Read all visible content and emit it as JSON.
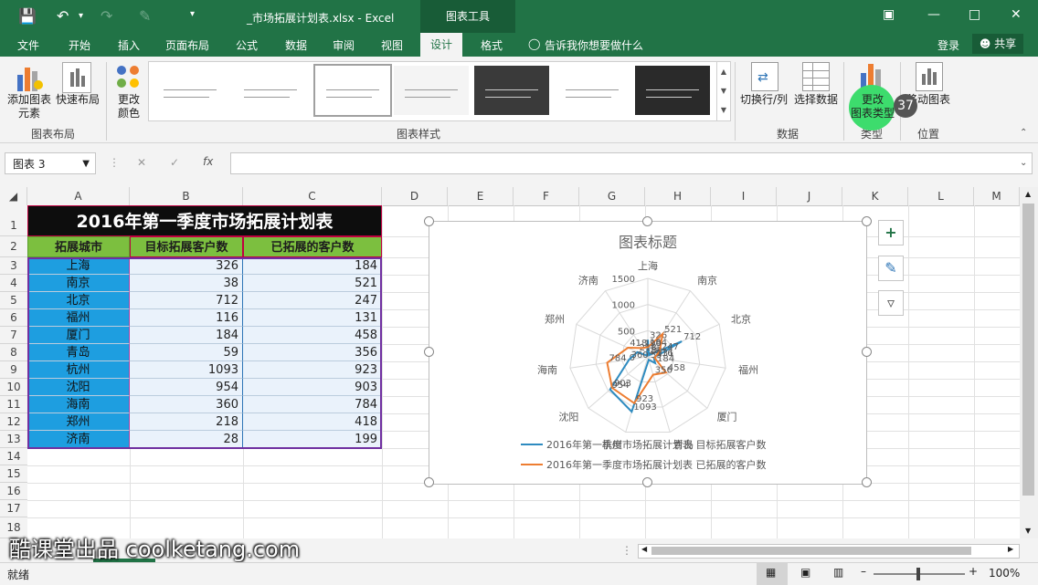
{
  "titlebar": {
    "doc_title": "_市场拓展计划表.xlsx - Excel",
    "context_tab": "图表工具",
    "signin": "登录",
    "share": "共享"
  },
  "tabs": [
    "文件",
    "开始",
    "插入",
    "页面布局",
    "公式",
    "数据",
    "审阅",
    "视图",
    "设计",
    "格式"
  ],
  "tellme": "告诉我你想要做什么",
  "ribbon": {
    "add_element": "添加图表\n元素",
    "quick_layout": "快速布局",
    "change_colors": "更改\n颜色",
    "switch_rowcol": "切换行/列",
    "select_data": "选择数据",
    "change_type": "更改\n图表类型",
    "move_chart": "移动图表",
    "groups": [
      "图表布局",
      "图表样式",
      "数据",
      "类型",
      "位置"
    ]
  },
  "namebox": "图表 3",
  "columns": [
    "A",
    "B",
    "C",
    "D",
    "E",
    "F",
    "G",
    "H",
    "I",
    "J",
    "K",
    "L",
    "M"
  ],
  "rows": [
    "1",
    "2",
    "3",
    "4",
    "5",
    "6",
    "7",
    "8",
    "9",
    "10",
    "11",
    "12",
    "13",
    "14",
    "15",
    "16",
    "17",
    "18"
  ],
  "sheet": {
    "title": "2016年第一季度市场拓展计划表",
    "headers": [
      "拓展城市",
      "目标拓展客户数",
      "已拓展的客户数"
    ],
    "data": [
      [
        "上海",
        "326",
        "184"
      ],
      [
        "南京",
        "38",
        "521"
      ],
      [
        "北京",
        "712",
        "247"
      ],
      [
        "福州",
        "116",
        "131"
      ],
      [
        "厦门",
        "184",
        "458"
      ],
      [
        "青岛",
        "59",
        "356"
      ],
      [
        "杭州",
        "1093",
        "923"
      ],
      [
        "沈阳",
        "954",
        "903"
      ],
      [
        "海南",
        "360",
        "784"
      ],
      [
        "郑州",
        "218",
        "418"
      ],
      [
        "济南",
        "28",
        "199"
      ]
    ]
  },
  "chart_data": {
    "type": "radar",
    "title": "图表标题",
    "categories": [
      "上海",
      "南京",
      "北京",
      "福州",
      "厦门",
      "青岛",
      "杭州",
      "沈阳",
      "海南",
      "郑州",
      "济南"
    ],
    "axis_ticks": [
      "0",
      "500",
      "1000",
      "1500"
    ],
    "ylim": [
      0,
      1500
    ],
    "series": [
      {
        "name": "2016年第一季度市场拓展计划表 目标拓展客户数",
        "color": "#2e8bc0",
        "values": [
          326,
          38,
          712,
          116,
          184,
          59,
          1093,
          954,
          360,
          218,
          28
        ]
      },
      {
        "name": "2016年第一季度市场拓展计划表 已拓展的客户数",
        "color": "#ed7d31",
        "values": [
          184,
          521,
          247,
          131,
          458,
          356,
          923,
          903,
          784,
          418,
          199
        ]
      }
    ]
  },
  "status": {
    "left": "就绪",
    "zoom": "100%"
  },
  "watermark": "酷课堂出品 coolketang.com",
  "badge": "37"
}
